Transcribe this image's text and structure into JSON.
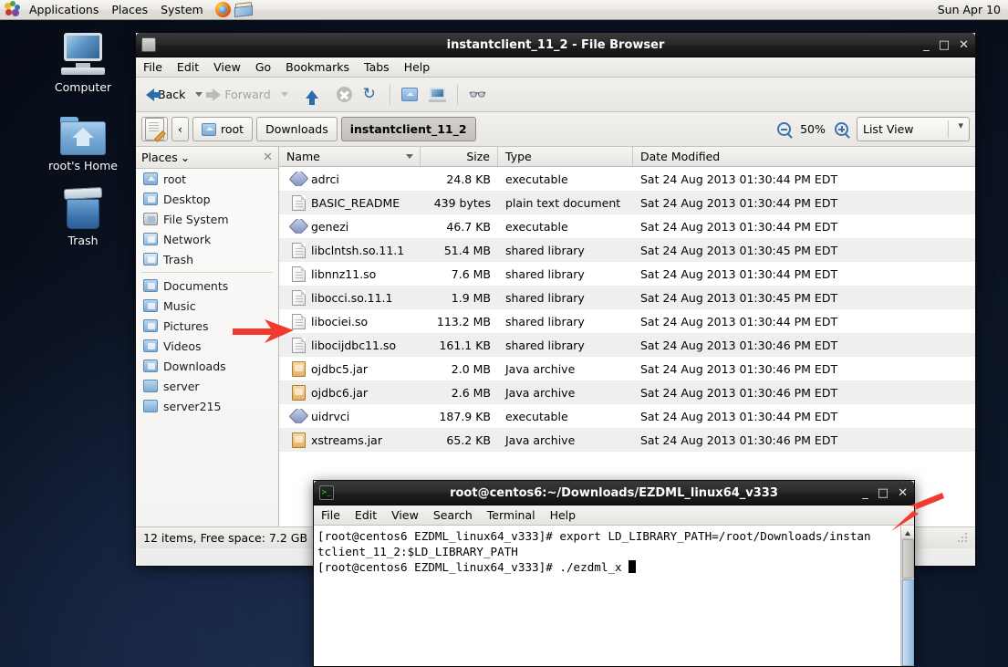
{
  "panel": {
    "logo_icon": "gnome-foot-icon",
    "menus": [
      "Applications",
      "Places",
      "System"
    ],
    "launchers": [
      "firefox-icon",
      "help-book-icon"
    ],
    "clock": "Sun Apr 10"
  },
  "desktop": {
    "icons": [
      {
        "label": "Computer",
        "icon": "computer-icon"
      },
      {
        "label": "root's Home",
        "icon": "home-folder-icon"
      },
      {
        "label": "Trash",
        "icon": "trash-icon"
      }
    ]
  },
  "file_browser": {
    "title": "instantclient_11_2 - File Browser",
    "window_buttons": {
      "minimize": "_",
      "maximize": "□",
      "close": "✕"
    },
    "menus": [
      "File",
      "Edit",
      "View",
      "Go",
      "Bookmarks",
      "Tabs",
      "Help"
    ],
    "toolbar": {
      "back": "Back",
      "forward": "Forward",
      "up_icon": "arrow-up-icon",
      "stop_icon": "stop-icon",
      "reload_icon": "reload-icon",
      "home_icon": "home-icon",
      "computer_icon": "computer-icon",
      "search_icon": "binoculars-search-icon"
    },
    "location": {
      "edit_icon": "edit-location-icon",
      "prev_chevron": "‹",
      "crumbs": [
        {
          "label": "root",
          "icon": "home-icon",
          "active": false
        },
        {
          "label": "Downloads",
          "icon": null,
          "active": false
        },
        {
          "label": "instantclient_11_2",
          "icon": null,
          "active": true
        }
      ],
      "zoom_out_icon": "zoom-out-icon",
      "zoom_level": "50%",
      "zoom_in_icon": "zoom-in-icon",
      "view_mode": "List View"
    },
    "places": {
      "header": "Places",
      "header_chevron": "⌄",
      "close_icon": "close-icon",
      "group1": [
        {
          "label": "root",
          "icon": "home-icon"
        },
        {
          "label": "Desktop",
          "icon": "desktop-icon"
        },
        {
          "label": "File System",
          "icon": "filesystem-icon"
        },
        {
          "label": "Network",
          "icon": "network-icon"
        },
        {
          "label": "Trash",
          "icon": "trash-icon"
        }
      ],
      "group2": [
        {
          "label": "Documents",
          "icon": "documents-folder-icon"
        },
        {
          "label": "Music",
          "icon": "music-folder-icon"
        },
        {
          "label": "Pictures",
          "icon": "pictures-folder-icon"
        },
        {
          "label": "Videos",
          "icon": "videos-folder-icon"
        },
        {
          "label": "Downloads",
          "icon": "downloads-folder-icon"
        },
        {
          "label": "server",
          "icon": "folder-icon"
        },
        {
          "label": "server215",
          "icon": "folder-icon"
        }
      ]
    },
    "columns": [
      "Name",
      "Size",
      "Type",
      "Date Modified"
    ],
    "rows": [
      {
        "name": "adrci",
        "size": "24.8 KB",
        "type": "executable",
        "date": "Sat 24 Aug 2013 01:30:44 PM EDT",
        "icon": "executable-icon"
      },
      {
        "name": "BASIC_README",
        "size": "439 bytes",
        "type": "plain text document",
        "date": "Sat 24 Aug 2013 01:30:44 PM EDT",
        "icon": "document-icon"
      },
      {
        "name": "genezi",
        "size": "46.7 KB",
        "type": "executable",
        "date": "Sat 24 Aug 2013 01:30:44 PM EDT",
        "icon": "executable-icon"
      },
      {
        "name": "libclntsh.so.11.1",
        "size": "51.4 MB",
        "type": "shared library",
        "date": "Sat 24 Aug 2013 01:30:45 PM EDT",
        "icon": "document-icon"
      },
      {
        "name": "libnnz11.so",
        "size": "7.6 MB",
        "type": "shared library",
        "date": "Sat 24 Aug 2013 01:30:44 PM EDT",
        "icon": "document-icon"
      },
      {
        "name": "libocci.so.11.1",
        "size": "1.9 MB",
        "type": "shared library",
        "date": "Sat 24 Aug 2013 01:30:45 PM EDT",
        "icon": "document-icon"
      },
      {
        "name": "libociei.so",
        "size": "113.2 MB",
        "type": "shared library",
        "date": "Sat 24 Aug 2013 01:30:44 PM EDT",
        "icon": "document-icon"
      },
      {
        "name": "libocijdbc11.so",
        "size": "161.1 KB",
        "type": "shared library",
        "date": "Sat 24 Aug 2013 01:30:46 PM EDT",
        "icon": "document-icon"
      },
      {
        "name": "ojdbc5.jar",
        "size": "2.0 MB",
        "type": "Java archive",
        "date": "Sat 24 Aug 2013 01:30:46 PM EDT",
        "icon": "jar-icon"
      },
      {
        "name": "ojdbc6.jar",
        "size": "2.6 MB",
        "type": "Java archive",
        "date": "Sat 24 Aug 2013 01:30:46 PM EDT",
        "icon": "jar-icon"
      },
      {
        "name": "uidrvci",
        "size": "187.9 KB",
        "type": "executable",
        "date": "Sat 24 Aug 2013 01:30:44 PM EDT",
        "icon": "executable-icon"
      },
      {
        "name": "xstreams.jar",
        "size": "65.2 KB",
        "type": "Java archive",
        "date": "Sat 24 Aug 2013 01:30:46 PM EDT",
        "icon": "jar-icon"
      }
    ],
    "status": "12 items, Free space: 7.2 GB"
  },
  "terminal": {
    "title": "root@centos6:~/Downloads/EZDML_linux64_v333",
    "window_buttons": {
      "minimize": "_",
      "maximize": "□",
      "close": "✕"
    },
    "menus": [
      "File",
      "Edit",
      "View",
      "Search",
      "Terminal",
      "Help"
    ],
    "lines": [
      "[root@centos6 EZDML_linux64_v333]# export LD_LIBRARY_PATH=/root/Downloads/instan",
      "tclient_11_2:$LD_LIBRARY_PATH",
      "[root@centos6 EZDML_linux64_v333]# ./ezdml_x "
    ]
  },
  "annotations": {
    "arrow_color": "#f23b30",
    "arrows": [
      {
        "name": "arrow-pointing-libociei",
        "target": "libociei.so"
      },
      {
        "name": "arrow-pointing-terminal-close",
        "target": "terminal close button"
      }
    ]
  }
}
